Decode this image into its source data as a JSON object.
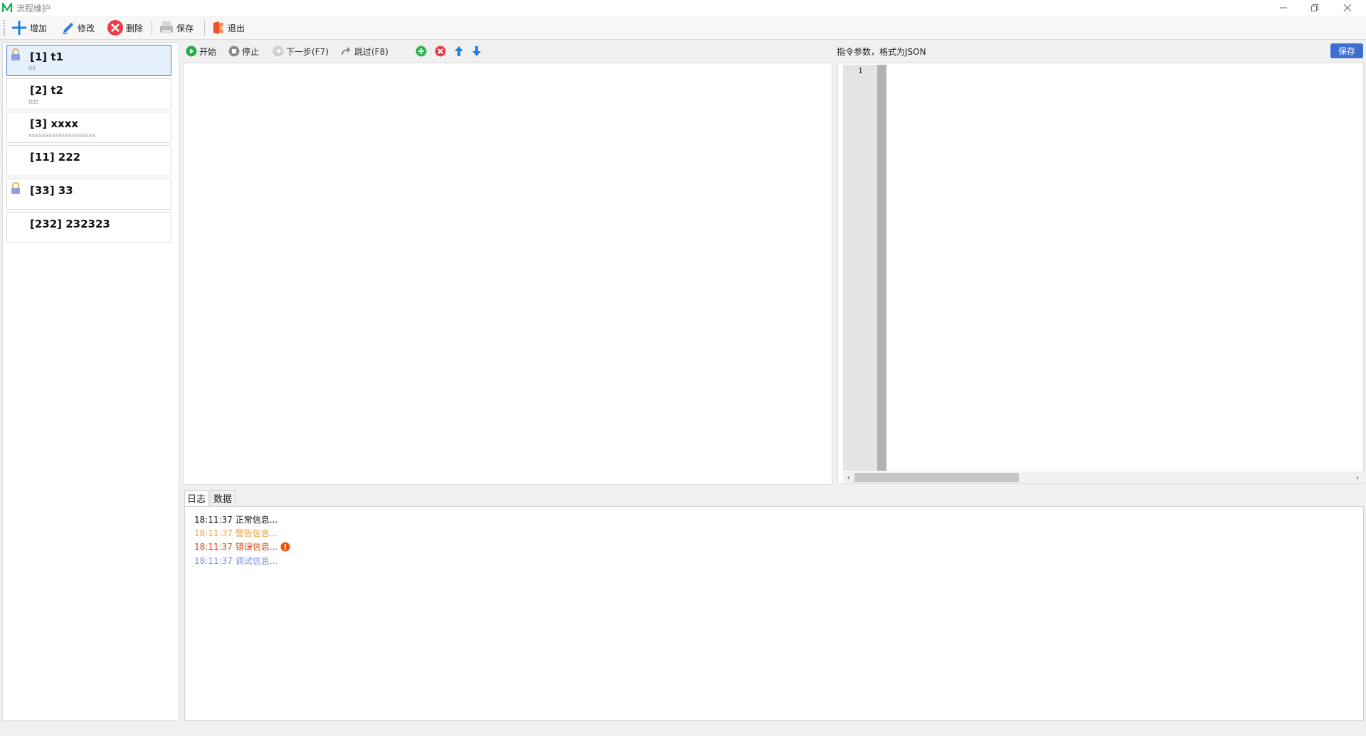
{
  "window": {
    "title": "流程维护",
    "controls": [
      "minimize",
      "restore",
      "close"
    ]
  },
  "toolbar": {
    "add_label": "增加",
    "edit_label": "修改",
    "delete_label": "删除",
    "save_label": "保存",
    "exit_label": "退出"
  },
  "flow_list": [
    {
      "title": "[1] t1",
      "subtitle": "ttt",
      "locked": true,
      "selected": true
    },
    {
      "title": "[2] t2",
      "subtitle": "tttt",
      "locked": false,
      "selected": false
    },
    {
      "title": "[3] xxxx",
      "subtitle": "ssssssssssssssssssss",
      "locked": false,
      "selected": false
    },
    {
      "title": "[11] 222",
      "subtitle": "",
      "locked": false,
      "selected": false
    },
    {
      "title": "[33] 33",
      "subtitle": "",
      "locked": true,
      "selected": false
    },
    {
      "title": "[232] 232323",
      "subtitle": "",
      "locked": false,
      "selected": false
    }
  ],
  "flow_toolbar": {
    "start_label": "开始",
    "stop_label": "停止",
    "next_label": "下一步(F7)",
    "skip_label": "跳过(F8)"
  },
  "params": {
    "label": "指令参数，格式为JSON",
    "save_label": "保存",
    "line_number": "1"
  },
  "tabs": [
    {
      "label": "日志",
      "active": true
    },
    {
      "label": "数据",
      "active": false
    }
  ],
  "logs": [
    {
      "time": "18:11:37",
      "message": "正常信息...",
      "level": "normal"
    },
    {
      "time": "18:11:37",
      "message": "警告信息...",
      "level": "warning"
    },
    {
      "time": "18:11:37",
      "message": "错误信息...",
      "level": "error"
    },
    {
      "time": "18:11:37",
      "message": "调试信息...",
      "level": "debug"
    }
  ],
  "colors": {
    "accent": "#3d6fd1",
    "selected_bg": "#e6effc",
    "selected_border": "#4a78d8",
    "start_green": "#22b04a",
    "add_green": "#2db84d",
    "remove_red": "#e8404a",
    "arrow_blue": "#1e7ee8",
    "warning": "#f0a040",
    "error": "#e04010",
    "debug": "#7a8ee0",
    "exit_orange": "#e8552a"
  }
}
